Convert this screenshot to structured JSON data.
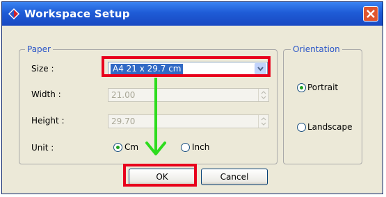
{
  "window": {
    "title": "Workspace Setup"
  },
  "paper": {
    "legend": "Paper",
    "size_label": "Size :",
    "size_value": "A4  21 x 29.7 cm",
    "width_label": "Width :",
    "width_value": "21.00",
    "height_label": "Height :",
    "height_value": "29.70",
    "unit_label": "Unit :",
    "unit_options": [
      "Cm",
      "Inch"
    ],
    "unit_selected": "Cm"
  },
  "orientation": {
    "legend": "Orientation",
    "options": [
      "Portrait",
      "Landscape"
    ],
    "selected": "Portrait"
  },
  "buttons": {
    "ok": "OK",
    "cancel": "Cancel"
  },
  "annotation": {
    "highlight_color": "#E8001C",
    "arrow_color": "#2EDC1E"
  },
  "colors": {
    "title_bar": "#1E5BD6",
    "dialog_bg": "#ECE9D8",
    "selection": "#316AC5"
  }
}
